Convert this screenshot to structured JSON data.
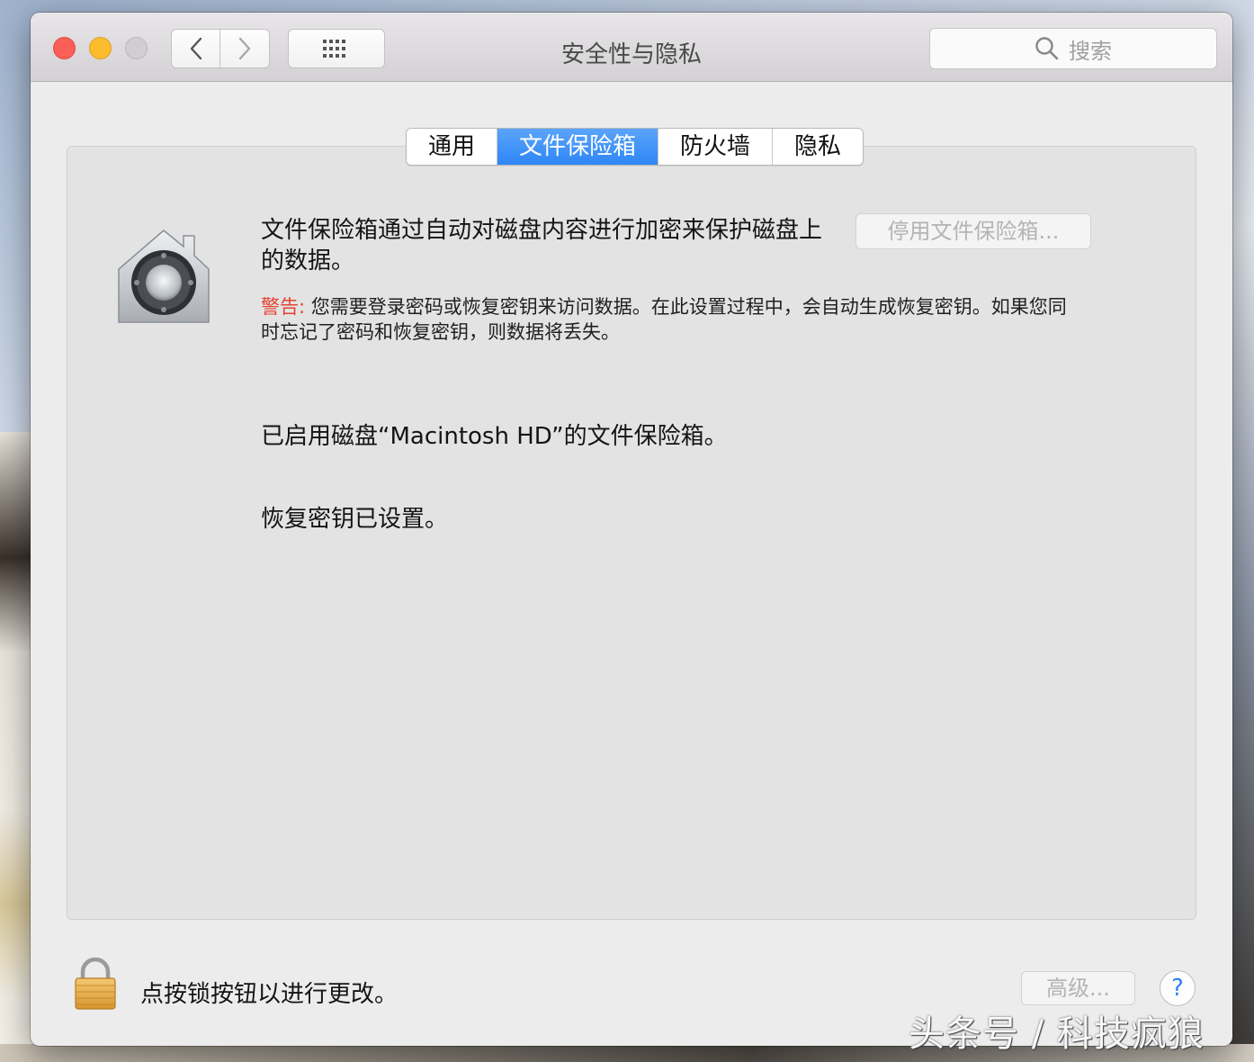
{
  "window": {
    "title": "安全性与隐私"
  },
  "search": {
    "placeholder": "搜索"
  },
  "tabs": [
    {
      "label": "通用",
      "active": false
    },
    {
      "label": "文件保险箱",
      "active": true
    },
    {
      "label": "防火墙",
      "active": false
    },
    {
      "label": "隐私",
      "active": false
    }
  ],
  "filevault": {
    "description": "文件保险箱通过自动对磁盘内容进行加密来保护磁盘上的数据。",
    "disable_button": "停用文件保险箱...",
    "warning_label": "警告:",
    "warning_text": "您需要登录密码或恢复密钥来访问数据。在此设置过程中，会自动生成恢复密钥。如果您同时忘记了密码和恢复密钥，则数据将丢失。",
    "status_enabled": "已启用磁盘“Macintosh HD”的文件保险箱。",
    "status_recovery": "恢复密钥已设置。"
  },
  "footer": {
    "lock_text": "点按锁按钮以进行更改。",
    "advanced_button": "高级...",
    "help_button": "?"
  },
  "watermark": "头条号 / 科技疯狼",
  "colors": {
    "accent": "#3a8ef7",
    "warning": "#e4432f",
    "close": "#fc5f57",
    "minimize": "#fdbc2e"
  }
}
